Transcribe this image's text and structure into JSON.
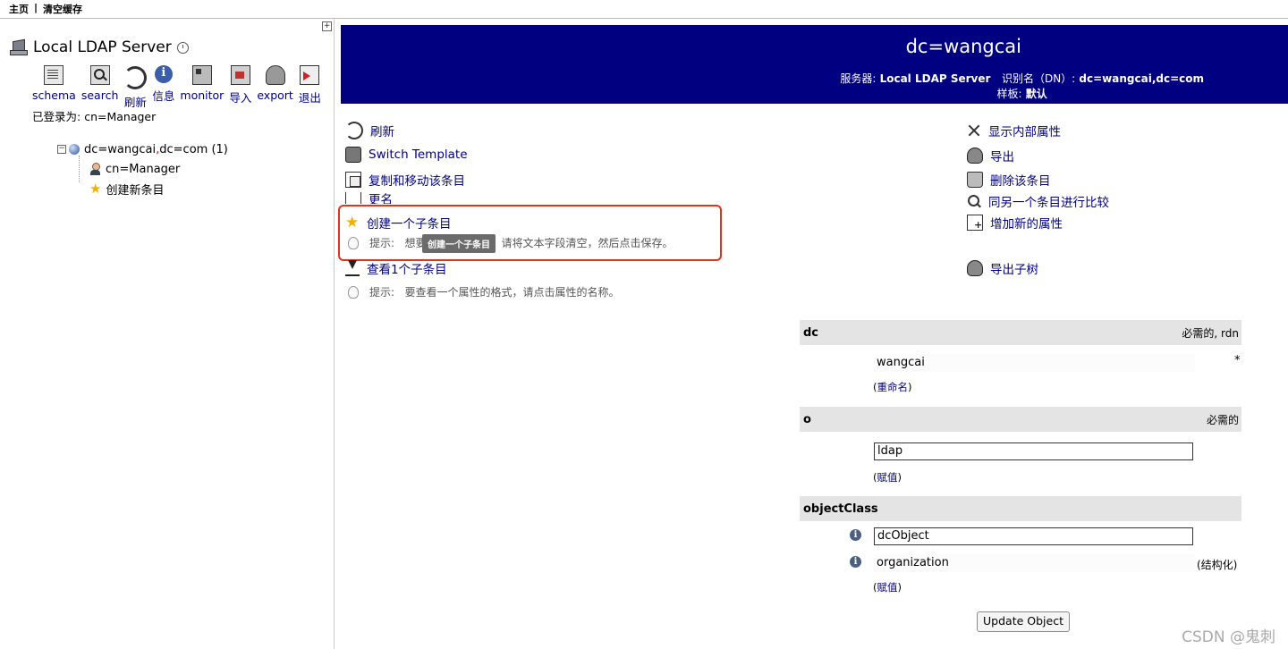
{
  "topbar": {
    "home": "主页",
    "separator": "|",
    "clear_cache": "清空缓存"
  },
  "left": {
    "expand_symbol": "+",
    "server_name": "Local LDAP Server",
    "toolbar": [
      {
        "label": "schema",
        "icon": "schema-icon"
      },
      {
        "label": "search",
        "icon": "search-icon"
      },
      {
        "label": "刷新",
        "icon": "refresh-icon"
      },
      {
        "label": "信息",
        "icon": "info-icon"
      },
      {
        "label": "monitor",
        "icon": "monitor-icon"
      },
      {
        "label": "导入",
        "icon": "import-icon"
      },
      {
        "label": "export",
        "icon": "export-icon"
      },
      {
        "label": "退出",
        "icon": "logout-icon"
      }
    ],
    "logged_in_label": "已登录为:",
    "logged_in_user": "cn=Manager",
    "tree": {
      "root_prefix": "dc=wangcai",
      "root_sep": ",",
      "root_suffix": "dc=com (1)",
      "child_1": "cn=Manager",
      "child_2": "创建新条目"
    }
  },
  "header": {
    "title": "dc=wangcai",
    "server_label": "服务器:",
    "server_value": "Local LDAP Server",
    "dn_label": "识别名（DN）:",
    "dn_value": "dc=wangcai,dc=com",
    "template_label": "样板:",
    "template_value": "默认"
  },
  "actions_left": {
    "refresh": "刷新",
    "switch_template": "Switch Template",
    "copy_move": "复制和移动该条目",
    "rename": "更名",
    "create_child": "创建一个子条目",
    "hint1_label": "提示:",
    "hint1_pre": "想要",
    "hint1_post": "请将文本字段清空，然后点击保存。",
    "tooltip": "创建一个子条目",
    "view_children": "查看1个子条目",
    "hint2_label": "提示:",
    "hint2_text": "要查看一个属性的格式，请点击属性的名称。"
  },
  "actions_right": {
    "show_internal": "显示内部属性",
    "export": "导出",
    "delete": "删除该条目",
    "compare": "同另一个条目进行比较",
    "add_attr": "增加新的属性",
    "export_subtree": "导出子树"
  },
  "attributes": {
    "dc": {
      "name": "dc",
      "req": "必需的, rdn",
      "value": "wangcai",
      "marker": "*",
      "link_open": "(",
      "link": "重命名",
      "link_close": ")"
    },
    "o": {
      "name": "o",
      "req": "必需的",
      "value": "ldap",
      "link_open": "(",
      "link": "赋值",
      "link_close": ")"
    },
    "objectClass": {
      "name": "objectClass",
      "value1": "dcObject",
      "value2": "organization",
      "value2_note": "(结构化)",
      "link_open": "(",
      "link": "赋值",
      "link_close": ")"
    }
  },
  "update_button": "Update Object",
  "watermark": "CSDN @鬼刺",
  "colors": {
    "header_bg": "#000080",
    "link": "#000080",
    "highlight": "#e0341e",
    "attr_head_bg": "#e4e4e4"
  }
}
